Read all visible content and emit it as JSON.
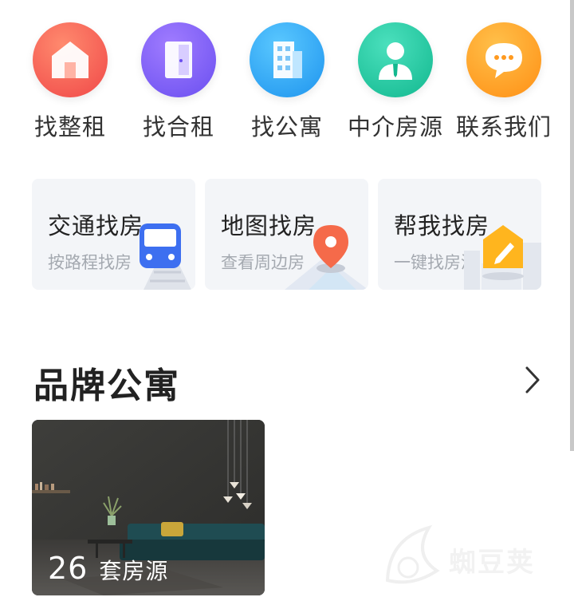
{
  "categories": [
    {
      "label": "找整租",
      "icon": "house-icon",
      "color": "#f45a4a"
    },
    {
      "label": "找合租",
      "icon": "door-icon",
      "color": "#7b5cf0"
    },
    {
      "label": "找公寓",
      "icon": "building-icon",
      "color": "#2aa6f2"
    },
    {
      "label": "中介房源",
      "icon": "agent-icon",
      "color": "#20c9a2"
    },
    {
      "label": "联系我们",
      "icon": "chat-icon",
      "color": "#ff9a1f"
    }
  ],
  "services": [
    {
      "title": "交通找房",
      "subtitle": "按路程找房",
      "icon": "train-icon"
    },
    {
      "title": "地图找房",
      "subtitle": "查看周边房",
      "icon": "map-pin-icon"
    },
    {
      "title": "帮我找房",
      "subtitle": "一键找房源",
      "icon": "edit-house-icon"
    }
  ],
  "brand_section": {
    "title": "品牌公寓",
    "more_icon": "chevron-right-icon"
  },
  "apartment_card": {
    "count": "26",
    "unit": "套房源"
  },
  "watermark": {
    "text": "蜘豆荚"
  }
}
